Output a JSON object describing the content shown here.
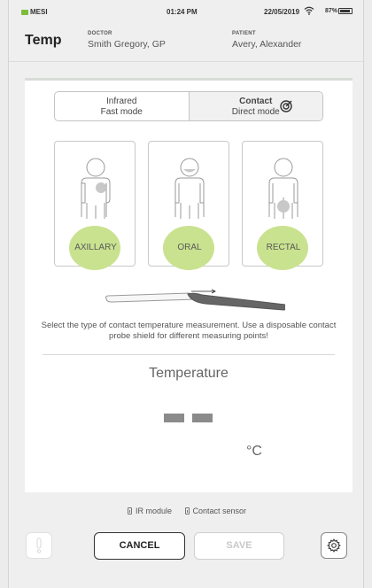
{
  "status_bar": {
    "brand": "MESI",
    "time": "01:24 PM",
    "date": "22/05/2019",
    "battery": "87%"
  },
  "header": {
    "title": "Temp",
    "doctor_label": "DOCTOR",
    "doctor_name": "Smith Gregory, GP",
    "patient_label": "PATIENT",
    "patient_name": "Avery, Alexander"
  },
  "modes": {
    "infrared_title": "Infrared",
    "infrared_sub": "Fast mode",
    "contact_title": "Contact",
    "contact_sub": "Direct mode",
    "active": "contact"
  },
  "sites": [
    {
      "label": "AXILLARY"
    },
    {
      "label": "ORAL"
    },
    {
      "label": "RECTAL"
    }
  ],
  "hint": "Select the type of contact temperature measurement. Use a disposable contact probe shield for different measuring points!",
  "reading": {
    "label": "Temperature",
    "value": "- -",
    "unit": "°C"
  },
  "footer": {
    "ir_module": "IR module",
    "contact_sensor": "Contact sensor",
    "cancel": "CANCEL",
    "save": "SAVE"
  },
  "colors": {
    "accent_green": "#c9e28f",
    "brand_green": "#7dbb3a"
  }
}
